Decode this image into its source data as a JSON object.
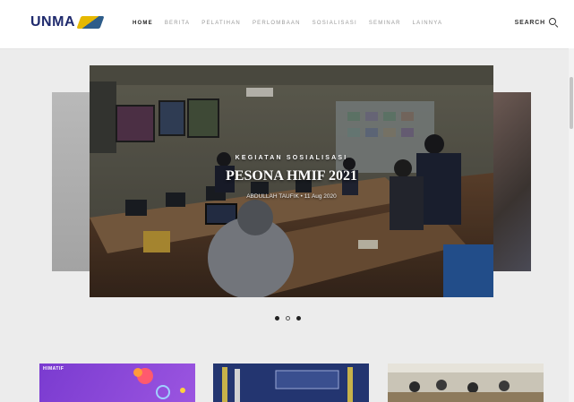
{
  "header": {
    "logo_text": "UNMA",
    "nav": [
      {
        "label": "HOME",
        "active": true
      },
      {
        "label": "BERITA",
        "active": false
      },
      {
        "label": "PELATIHAN",
        "active": false
      },
      {
        "label": "PERLOMBAAN",
        "active": false
      },
      {
        "label": "SOSIALISASI",
        "active": false
      },
      {
        "label": "SEMINAR",
        "active": false
      },
      {
        "label": "LAINNYA",
        "active": false
      }
    ],
    "search_label": "SEARCH"
  },
  "slider": {
    "category": "KEGIATAN SOSIALISASI",
    "title": "PESONA HMIF 2021",
    "meta": "ABDULLAH TAUFIK • 11 Aug 2020",
    "active_index": 1,
    "count": 3
  },
  "cards": [
    {
      "tag": "HIMATIF"
    }
  ],
  "colors": {
    "nav_active": "#222222",
    "nav_inactive": "#9a9a9a",
    "page_background": "#ececec"
  }
}
